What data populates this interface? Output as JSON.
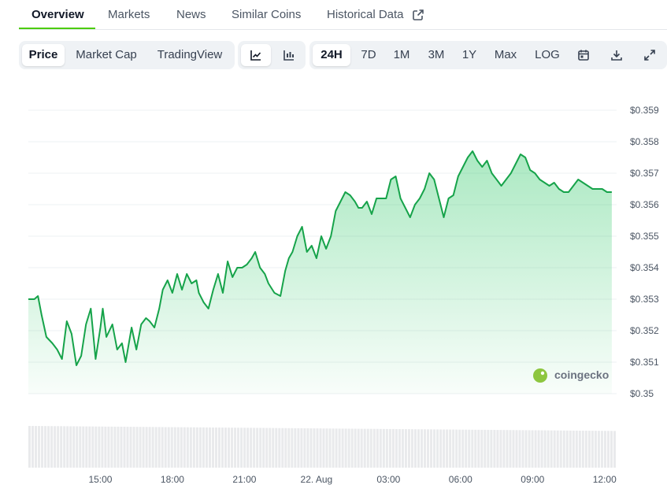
{
  "tabs": [
    {
      "label": "Overview",
      "active": true
    },
    {
      "label": "Markets"
    },
    {
      "label": "News"
    },
    {
      "label": "Similar Coins"
    },
    {
      "label": "Historical Data",
      "external": true
    }
  ],
  "chart_tabs": [
    {
      "label": "Price",
      "selected": true
    },
    {
      "label": "Market Cap"
    },
    {
      "label": "TradingView"
    }
  ],
  "chart_type_buttons": [
    {
      "icon": "line-chart-icon",
      "selected": true
    },
    {
      "icon": "candlestick-icon"
    }
  ],
  "ranges": [
    {
      "label": "24H",
      "selected": true
    },
    {
      "label": "7D"
    },
    {
      "label": "1M"
    },
    {
      "label": "3M"
    },
    {
      "label": "1Y"
    },
    {
      "label": "Max"
    },
    {
      "label": "LOG"
    }
  ],
  "tool_icons": [
    "calendar-icon",
    "download-icon",
    "expand-icon"
  ],
  "watermark": "coingecko",
  "colors": {
    "accent": "#4bcc00",
    "line": "#16a34a",
    "area": "#22c55e"
  },
  "chart_data": {
    "type": "area",
    "xlabel": "",
    "ylabel": "",
    "x_ticks": [
      "15:00",
      "18:00",
      "21:00",
      "22. Aug",
      "03:00",
      "06:00",
      "09:00",
      "12:00"
    ],
    "x_tick_hours": [
      3,
      6,
      9,
      12,
      15,
      18,
      21,
      24
    ],
    "x_range_hours": [
      0,
      24.5
    ],
    "y_ticks": [
      "$0.359",
      "$0.358",
      "$0.357",
      "$0.356",
      "$0.355",
      "$0.354",
      "$0.353",
      "$0.352",
      "$0.351",
      "$0.35"
    ],
    "y_tick_values": [
      0.359,
      0.358,
      0.357,
      0.356,
      0.355,
      0.354,
      0.353,
      0.352,
      0.351,
      0.35
    ],
    "ylim": [
      0.35,
      0.359
    ],
    "grid": true,
    "series": [
      {
        "x_hours": [
          0,
          0.25,
          0.4,
          0.55,
          0.75,
          1.0,
          1.2,
          1.4,
          1.6,
          1.8,
          2.0,
          2.2,
          2.4,
          2.6,
          2.8,
          3.0,
          3.1,
          3.25,
          3.5,
          3.7,
          3.9,
          4.05,
          4.3,
          4.5,
          4.7,
          4.9,
          5.05,
          5.25,
          5.45,
          5.6,
          5.8,
          6.0,
          6.2,
          6.4,
          6.6,
          6.8,
          7.0,
          7.1,
          7.3,
          7.5,
          7.7,
          7.9,
          8.1,
          8.3,
          8.5,
          8.7,
          8.9,
          9.1,
          9.3,
          9.45,
          9.65,
          9.85,
          10.0,
          10.25,
          10.5,
          10.7,
          10.85,
          11.0,
          11.2,
          11.4,
          11.6,
          11.8,
          12.0,
          12.2,
          12.4,
          12.6,
          12.8,
          13.0,
          13.2,
          13.4,
          13.6,
          13.75,
          13.9,
          14.1,
          14.3,
          14.5,
          14.7,
          14.9,
          15.1,
          15.3,
          15.5,
          15.7,
          15.9,
          16.1,
          16.3,
          16.5,
          16.7,
          16.9,
          17.1,
          17.3,
          17.5,
          17.7,
          17.9,
          18.1,
          18.3,
          18.5,
          18.7,
          18.9,
          19.1,
          19.3,
          19.5,
          19.7,
          19.9,
          20.1,
          20.3,
          20.5,
          20.7,
          20.9,
          21.1,
          21.3,
          21.5,
          21.7,
          21.9,
          22.1,
          22.3,
          22.5,
          22.7,
          22.9,
          23.1,
          23.3,
          23.5,
          23.7,
          23.9,
          24.1,
          24.3
        ],
        "values": [
          0.353,
          0.353,
          0.3531,
          0.3525,
          0.3518,
          0.3516,
          0.3514,
          0.3511,
          0.3523,
          0.3519,
          0.3509,
          0.3512,
          0.3522,
          0.3527,
          0.3511,
          0.3521,
          0.3527,
          0.3518,
          0.3522,
          0.3514,
          0.3516,
          0.351,
          0.3521,
          0.3514,
          0.3522,
          0.3524,
          0.3523,
          0.3521,
          0.3527,
          0.3533,
          0.3536,
          0.3532,
          0.3538,
          0.3533,
          0.3538,
          0.3535,
          0.3536,
          0.3532,
          0.3529,
          0.3527,
          0.3533,
          0.3538,
          0.3532,
          0.3542,
          0.3537,
          0.354,
          0.354,
          0.3541,
          0.3543,
          0.3545,
          0.354,
          0.3538,
          0.3535,
          0.3532,
          0.3531,
          0.3539,
          0.3543,
          0.3545,
          0.355,
          0.3553,
          0.3545,
          0.3547,
          0.3543,
          0.355,
          0.3546,
          0.355,
          0.3558,
          0.3561,
          0.3564,
          0.3563,
          0.3561,
          0.3559,
          0.3559,
          0.3561,
          0.3557,
          0.3562,
          0.3562,
          0.3562,
          0.3568,
          0.3569,
          0.3562,
          0.3559,
          0.3556,
          0.356,
          0.3562,
          0.3565,
          0.357,
          0.3568,
          0.3562,
          0.3556,
          0.3562,
          0.3563,
          0.3569,
          0.3572,
          0.3575,
          0.3577,
          0.3574,
          0.3572,
          0.3574,
          0.357,
          0.3568,
          0.3566,
          0.3568,
          0.357,
          0.3573,
          0.3576,
          0.3575,
          0.3571,
          0.357,
          0.3568,
          0.3567,
          0.3566,
          0.3567,
          0.3565,
          0.3564,
          0.3564,
          0.3566,
          0.3568,
          0.3567,
          0.3566,
          0.3565,
          0.3565,
          0.3565,
          0.3564,
          0.3564
        ]
      }
    ],
    "volume": {
      "bars": 186,
      "relative_min": 0.88,
      "relative_max": 1.0
    }
  }
}
